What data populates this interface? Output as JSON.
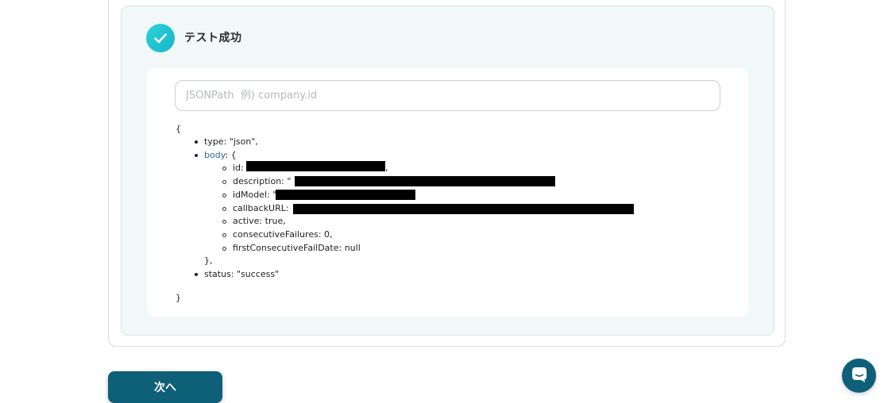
{
  "result": {
    "status_title": "テスト成功",
    "jsonpath_placeholder": "JSONPath  例) company.id",
    "jsonpath_value": ""
  },
  "json_tree": {
    "open_brace": "{",
    "type_line": "type: \"json\",",
    "body_key": "body",
    "body_open": ": {",
    "fields": {
      "id": "id:",
      "id_trailing": ",",
      "description": "description: \"",
      "idModel": "idModel: \"",
      "callbackURL": "callbackURL:",
      "active": "active: true,",
      "consecutiveFailures": "consecutiveFailures: 0,",
      "firstConsecutiveFailDate": "firstConsecutiveFailDate: null"
    },
    "body_close": "},",
    "status_line": "status: \"success\"",
    "close_brace": "}"
  },
  "footer": {
    "next_label": "次へ"
  },
  "icons": {
    "success": "checkmark-icon",
    "chat": "chat-icon"
  },
  "colors": {
    "accent": "#0e5f78",
    "success_gradient_start": "#2dd3d9",
    "panel_background": "#f1f8f7",
    "key_link": "#2a6b8f"
  }
}
